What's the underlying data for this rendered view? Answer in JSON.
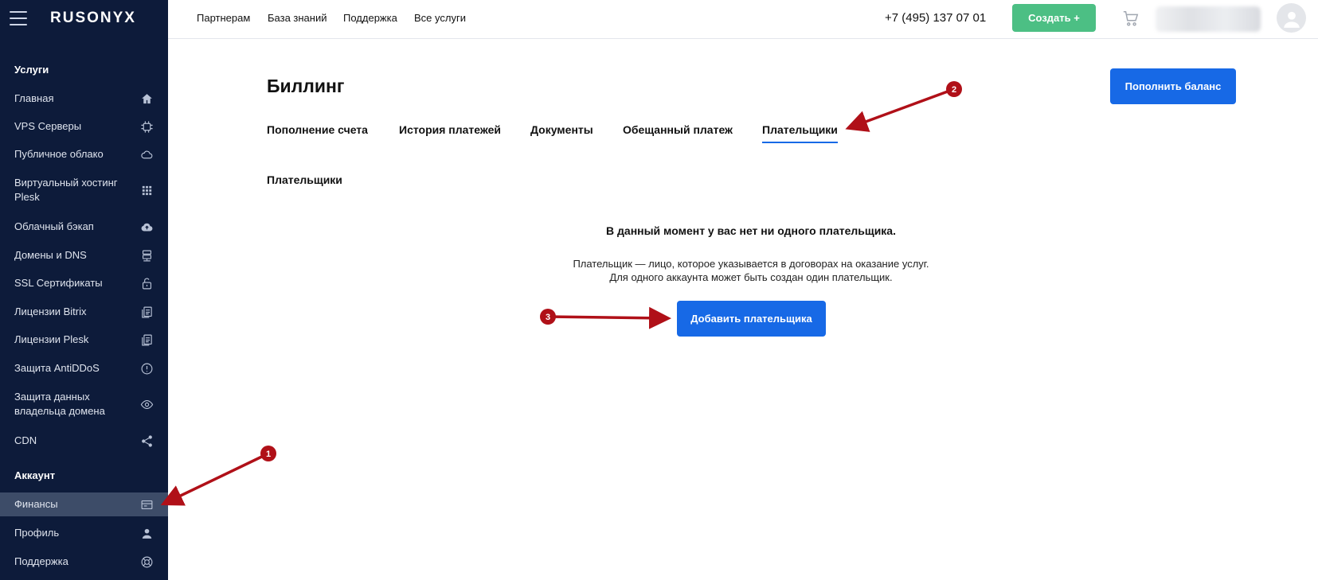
{
  "sidebar": {
    "logo": "RUSONYX",
    "services_heading": "Услуги",
    "services": [
      {
        "label": "Главная",
        "icon": "home-icon"
      },
      {
        "label": "VPS Серверы",
        "icon": "cpu-icon"
      },
      {
        "label": "Публичное облако",
        "icon": "cloud-icon"
      },
      {
        "label": "Виртуальный хостинг Plesk",
        "icon": "grid-icon"
      },
      {
        "label": "Облачный бэкап",
        "icon": "cloud-upload-icon"
      },
      {
        "label": "Домены и DNS",
        "icon": "dns-icon"
      },
      {
        "label": "SSL Сертификаты",
        "icon": "lock-icon"
      },
      {
        "label": "Лицензии Bitrix",
        "icon": "license-icon"
      },
      {
        "label": "Лицензии Plesk",
        "icon": "license-icon"
      },
      {
        "label": "Защита AntiDDoS",
        "icon": "alert-circle-icon"
      },
      {
        "label": "Защита данных владельца домена",
        "icon": "eye-icon"
      },
      {
        "label": "CDN",
        "icon": "share-icon"
      }
    ],
    "account_heading": "Аккаунт",
    "account": [
      {
        "label": "Финансы",
        "icon": "wallet-icon",
        "active": true
      },
      {
        "label": "Профиль",
        "icon": "user-icon"
      },
      {
        "label": "Поддержка",
        "icon": "lifebuoy-icon"
      }
    ]
  },
  "header": {
    "nav": [
      "Партнерам",
      "База знаний",
      "Поддержка",
      "Все услуги"
    ],
    "phone": "+7 (495) 137 07 01",
    "create_label": "Создать +"
  },
  "main": {
    "title": "Биллинг",
    "topup_label": "Пополнить баланс",
    "tabs": [
      {
        "label": "Пополнение счета"
      },
      {
        "label": "История платежей"
      },
      {
        "label": "Документы"
      },
      {
        "label": "Обещанный платеж"
      },
      {
        "label": "Плательщики",
        "active": true
      }
    ],
    "section_title": "Плательщики",
    "empty_title": "В данный момент у вас нет ни одного плательщика.",
    "empty_desc_line1": "Плательщик — лицо, которое указывается в договорах на оказание услуг.",
    "empty_desc_line2": "Для одного аккаунта может быть создан один плательщик.",
    "add_label": "Добавить плательщика"
  },
  "annotations": [
    "1",
    "2",
    "3"
  ],
  "colors": {
    "sidebar_bg": "#0d1b3a",
    "sidebar_active": "#3d4c68",
    "primary": "#1769e6",
    "create_green": "#4cbf84",
    "annotation_red": "#b01018"
  }
}
